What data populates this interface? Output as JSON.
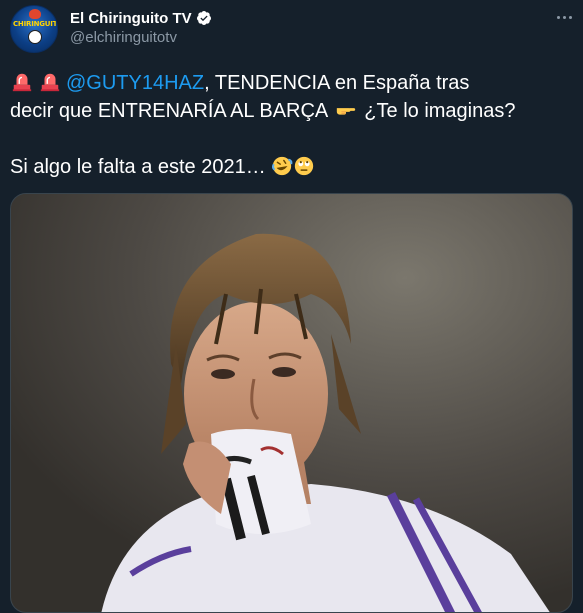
{
  "account": {
    "display_name": "El Chiringuito TV",
    "handle": "@elchiringuitotv",
    "avatar_text": "CHIRINGUITO"
  },
  "tweet": {
    "line1_mention": "@GUTY14HAZ",
    "line1_rest": ", TENDENCIA en España tras",
    "line2_text": "decir que ENTRENARÍA AL BARÇA",
    "line2_question": "¿Te lo imaginas?",
    "line3_text": "Si algo le falta a este 2021…"
  },
  "icons": {
    "verified": "verified-badge-icon",
    "more": "more-options-icon",
    "siren": "police-light-emoji",
    "pointing": "backhand-index-pointing-right-emoji",
    "laughing": "rolling-on-floor-laughing-emoji",
    "eye_roll": "face-with-rolling-eyes-emoji"
  },
  "colors": {
    "background": "#15202b",
    "accent": "#1d9bf0",
    "secondary_text": "#8b98a5"
  }
}
